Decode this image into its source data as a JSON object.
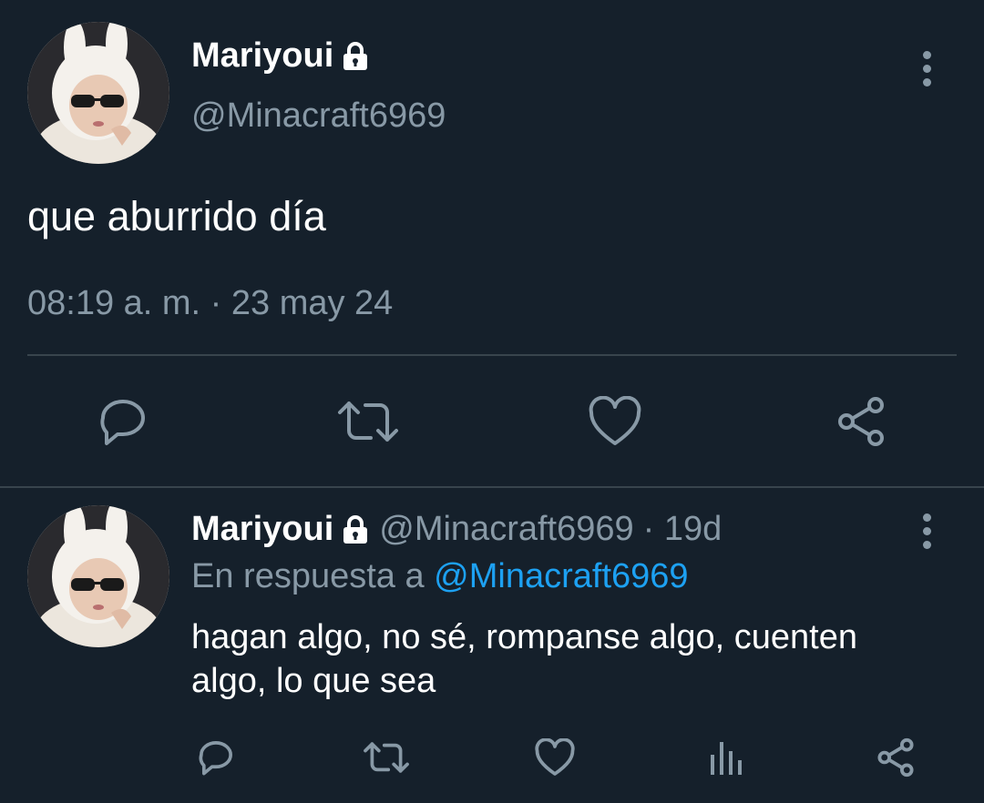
{
  "main_tweet": {
    "display_name": "Mariyoui",
    "handle": "@Minacraft6969",
    "text": "que aburrido día",
    "timestamp": "08:19 a. m. · 23 may 24",
    "icons": [
      "comment-icon",
      "retweet-icon",
      "like-icon",
      "share-icon"
    ]
  },
  "reply_tweet": {
    "display_name": "Mariyoui",
    "handle": "@Minacraft6969",
    "age": "· 19d",
    "reply_prefix": "En respuesta a",
    "reply_to": "@Minacraft6969",
    "text": "hagan algo, no sé, rompanse algo, cuenten algo, lo que sea",
    "icons": [
      "comment-icon",
      "retweet-icon",
      "like-icon",
      "analytics-icon",
      "share-icon"
    ]
  },
  "colors": {
    "background": "#15202b",
    "secondary_text": "#8899a6",
    "link": "#1da1f2",
    "divider": "#38444d"
  }
}
